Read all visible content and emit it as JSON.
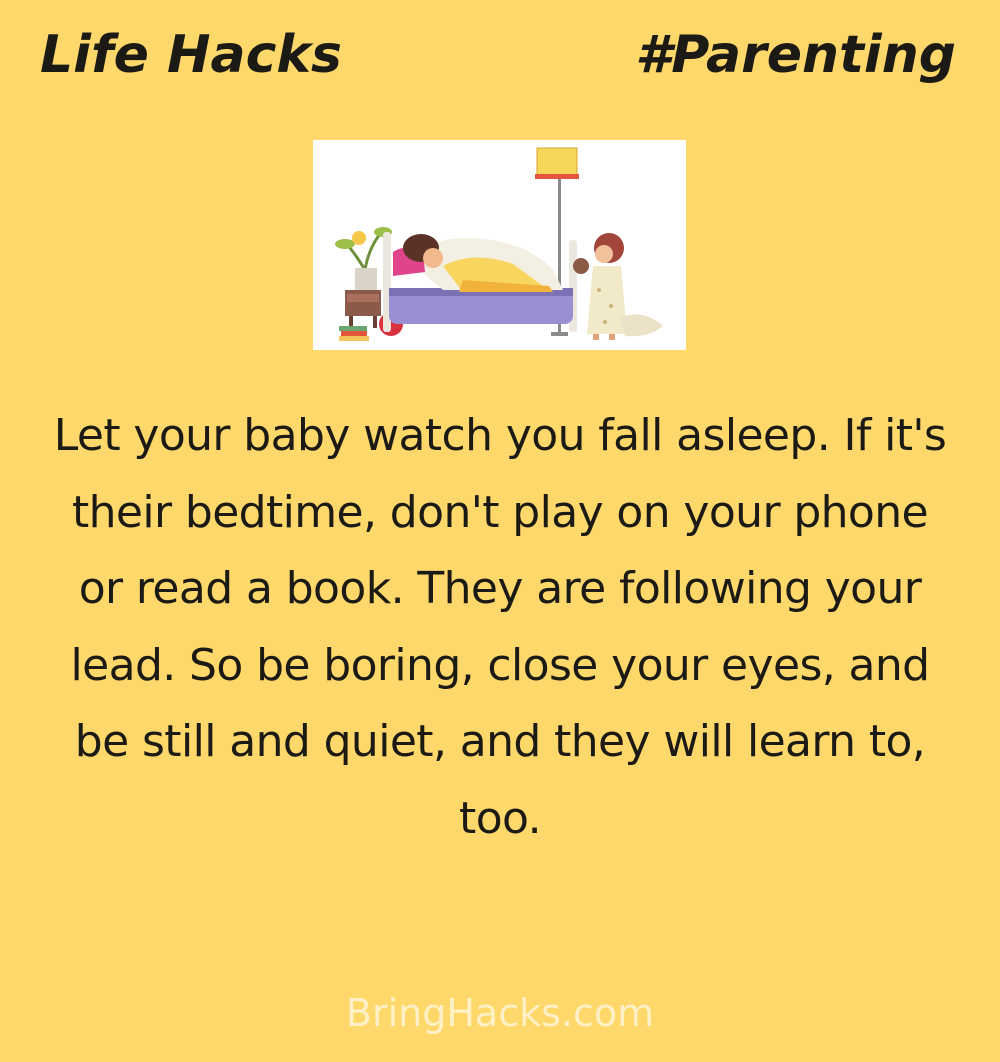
{
  "header": {
    "left_title": "Life Hacks",
    "right_title": "#Parenting"
  },
  "illustration": {
    "subject": "parent-sleeping-in-bed-with-child-illustration"
  },
  "tip": {
    "text": "Let your baby watch you fall asleep. If it's their bedtime, don't play on your phone or read a book. They are following your lead. So be boring, close your eyes, and be still and quiet, and they will learn to, too."
  },
  "footer": {
    "site": "BringHacks.com"
  },
  "colors": {
    "background": "#fed86a",
    "text": "#1c1a14",
    "footer_text": "#fff1c5"
  }
}
